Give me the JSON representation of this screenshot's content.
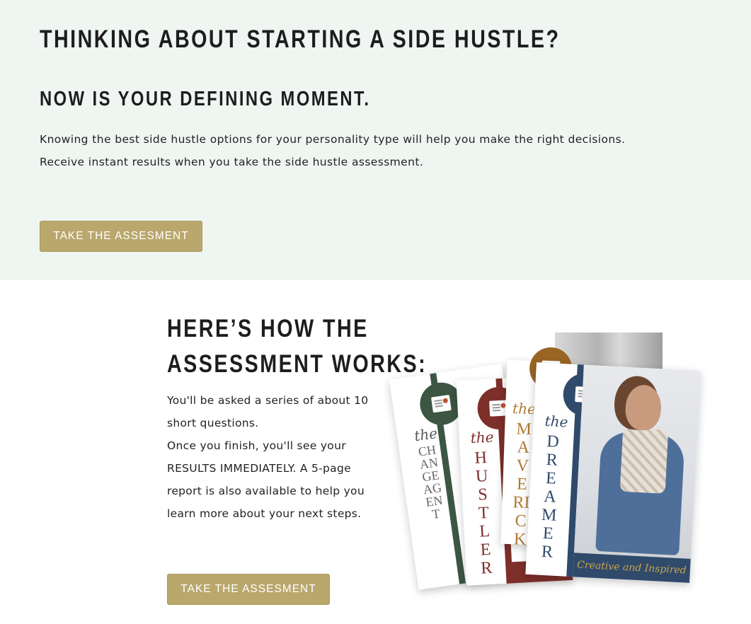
{
  "hero": {
    "title": "THINKING ABOUT STARTING A SIDE HUSTLE?",
    "subtitle": "NOW IS YOUR DEFINING MOMENT.",
    "text_lines": [
      "Knowing the best side hustle options for your personality type will help you make the right decisions.",
      "Receive instant results when you take the side hustle assessment."
    ],
    "button_label": "TAKE THE ASSESMENT"
  },
  "how": {
    "title_lines": [
      "HERE’S HOW THE",
      "ASSESSMENT WORKS:"
    ],
    "text_lines": [
      "You'll be asked a series of  about 10",
      "short questions.",
      "Once you finish, you'll see your",
      "RESULTS IMMEDIATELY. A 5-page",
      "report is also available to help you",
      "learn more about your next steps."
    ],
    "button_label": "TAKE THE ASSESMENT"
  },
  "brochures": {
    "script_the": "the",
    "cards": [
      {
        "word": "CHANGE AGENT",
        "color": "#3c5642"
      },
      {
        "word": "HUSTLER",
        "color": "#7d2f2a"
      },
      {
        "word": "MAVERICK",
        "color": "#9a6424"
      },
      {
        "word": "DREAMER",
        "color": "#2f4a6b"
      }
    ],
    "tagline": "Creative and Inspired"
  },
  "colors": {
    "hero_bg": "#eff6f2",
    "button_bg": "#b9a76c",
    "heading": "#1d1d1d"
  }
}
